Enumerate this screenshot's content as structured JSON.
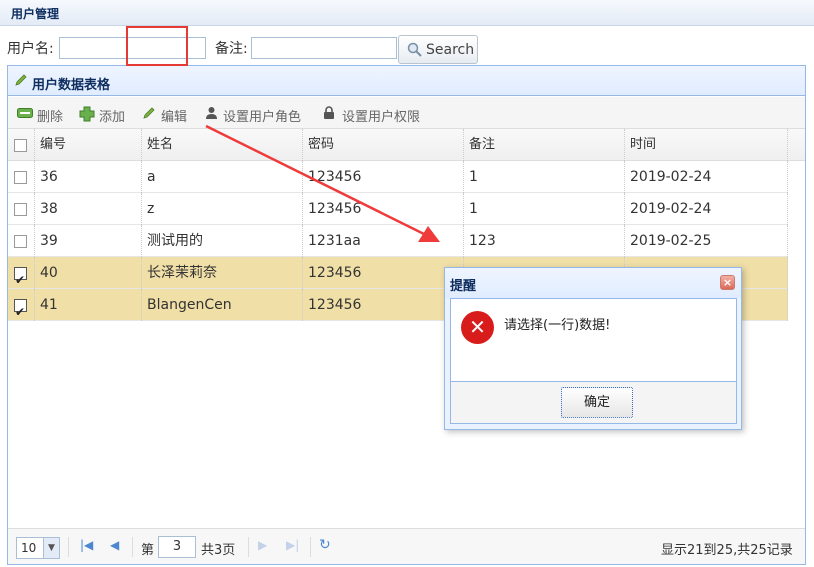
{
  "header": {
    "title": "用户管理"
  },
  "search": {
    "username_label": "用户名:",
    "remark_label": "备注:",
    "button_label": "Search"
  },
  "panel": {
    "title": "用户数据表格"
  },
  "toolbar": {
    "delete": "删除",
    "add": "添加",
    "edit": "编辑",
    "set_role": "设置用户角色",
    "set_permission": "设置用户权限"
  },
  "table": {
    "columns": [
      "编号",
      "姓名",
      "密码",
      "备注",
      "时间"
    ],
    "rows": [
      {
        "id": "36",
        "name": "a",
        "password": "123456",
        "remark": "1",
        "time": "2019-02-24",
        "checked": false
      },
      {
        "id": "38",
        "name": "z",
        "password": "123456",
        "remark": "1",
        "time": "2019-02-24",
        "checked": false
      },
      {
        "id": "39",
        "name": "测试用的",
        "password": "1231aa",
        "remark": "123",
        "time": "2019-02-25",
        "checked": false
      },
      {
        "id": "40",
        "name": "长泽茉莉奈",
        "password": "123456",
        "remark": "",
        "time": "",
        "checked": true
      },
      {
        "id": "41",
        "name": "BlangenCen",
        "password": "123456",
        "remark": "",
        "time": "",
        "checked": true
      }
    ]
  },
  "pager": {
    "page_size": "10",
    "page_label_before": "第",
    "page_number": "3",
    "page_label_after": "共3页",
    "summary": "显示21到25,共25记录"
  },
  "dialog": {
    "title": "提醒",
    "message": "请选择(一行)数据!",
    "ok_label": "确定"
  },
  "colors": {
    "selected_row": "#f0dfa7",
    "border": "#95b8e7",
    "highlight": "#e53935",
    "error_icon": "#d81b1b"
  }
}
